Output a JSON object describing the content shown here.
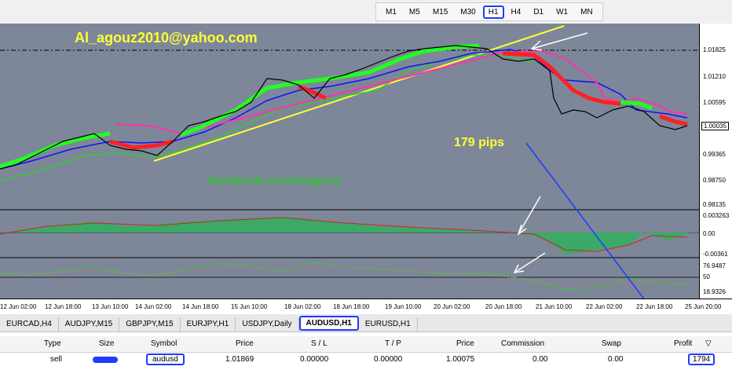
{
  "timeframes": [
    "M1",
    "M5",
    "M15",
    "M30",
    "H1",
    "H4",
    "D1",
    "W1",
    "MN"
  ],
  "active_timeframe": "H1",
  "overlays": {
    "email": "Al_agouz2010@yahoo.com",
    "facebook": "facebook.com/elagouz",
    "pips": "179 pips"
  },
  "price_scale": {
    "main": [
      "1.01825",
      "1.01210",
      "1.00595",
      "1.00035",
      "0.99365",
      "0.98750",
      "0.98135"
    ],
    "current": "1.00035",
    "osc1": [
      "0.003263",
      "0.00",
      "-0.00361"
    ],
    "osc2": [
      "76.9487",
      "50",
      "18.9326"
    ]
  },
  "time_labels": [
    "12 Jun 02:00",
    "12 Jun 18:00",
    "13 Jun 10:00",
    "14 Jun 02:00",
    "14 Jun 18:00",
    "15 Jun 10:00",
    "18 Jun 02:00",
    "18 Jun 18:00",
    "19 Jun 10:00",
    "20 Jun 02:00",
    "20 Jun 18:00",
    "21 Jun 10:00",
    "22 Jun 02:00",
    "22 Jun 18:00",
    "25 Jun 20:00"
  ],
  "tabs": [
    "EURCAD,H4",
    "AUDJPY,M15",
    "GBPJPY,M15",
    "EURJPY,H1",
    "USDJPY,Daily",
    "AUDUSD,H1",
    "EURUSD,H1"
  ],
  "active_tab": "AUDUSD,H1",
  "trade_table": {
    "headers": {
      "type": "Type",
      "size": "Size",
      "symbol": "Symbol",
      "price": "Price",
      "sl": "S / L",
      "tp": "T / P",
      "price2": "Price",
      "commission": "Commission",
      "swap": "Swap",
      "profit": "Profit"
    },
    "row": {
      "type": "sell",
      "size": "",
      "symbol": "audusd",
      "price": "1.01869",
      "sl": "0.00000",
      "tp": "0.00000",
      "price2": "1.00075",
      "commission": "0.00",
      "swap": "0.00",
      "profit": "1794"
    }
  },
  "colors": {
    "background": "#7d8799",
    "bull": "#22ff22",
    "bear": "#ff2020",
    "blue_line": "#1010ff",
    "green_line": "#33cc33",
    "magenta_line": "#ff33aa",
    "trendline": "#ffff33",
    "annotation": "#1f3bff"
  }
}
